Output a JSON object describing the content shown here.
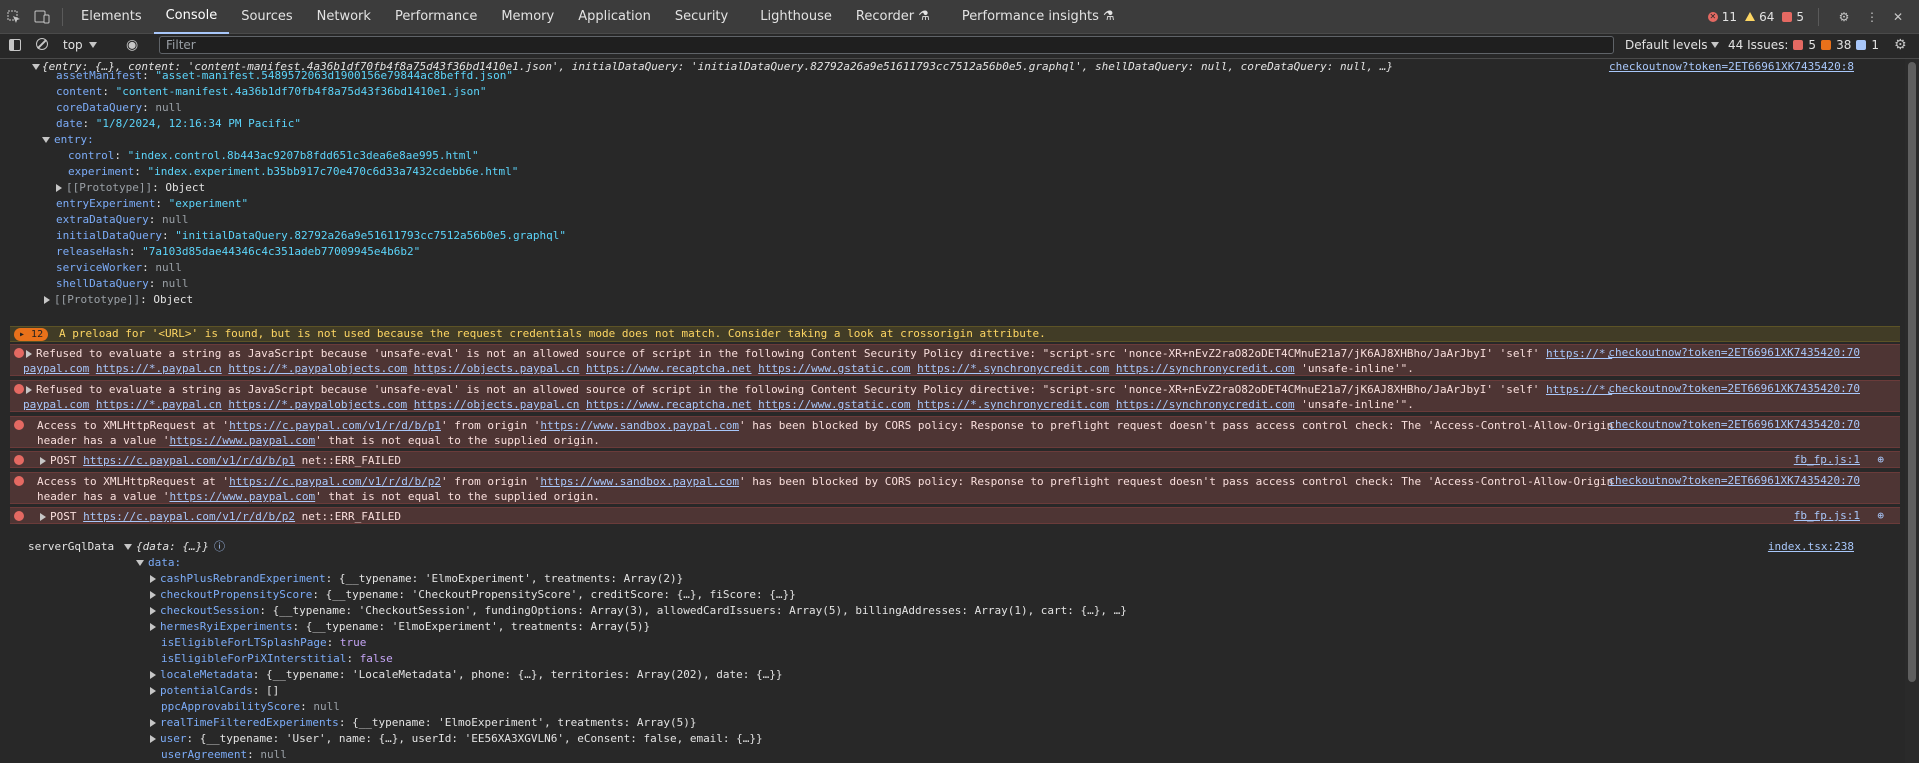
{
  "tabs": [
    "Elements",
    "Console",
    "Sources",
    "Network",
    "Performance",
    "Memory",
    "Application",
    "Security",
    "Lighthouse",
    "Recorder",
    "Performance insights"
  ],
  "status": {
    "errors": "11",
    "warnings": "64",
    "issues_small": "5"
  },
  "filter": {
    "context": "top",
    "placeholder": "Filter",
    "levels": "Default levels",
    "issues_label": "44 Issues:",
    "issue_err": "5",
    "issue_warn": "38",
    "issue_info": "1"
  },
  "console": {
    "obj_summary": "{entry: {…}, content: 'content-manifest.4a36b1df70fb4f8a75d43f36bd1410e1.json', initialDataQuery: 'initialDataQuery.82792a26a9e51611793cc7512a56b0e5.graphql', shellDataQuery: null, coreDataQuery: null, …}",
    "obj_src": "checkoutnow?token=2ET66961XK7435420:8",
    "props": [
      {
        "k": "assetManifest",
        "v": "\"asset-manifest.5489572063d1900156e79844ac8beffd.json\""
      },
      {
        "k": "content",
        "v": "\"content-manifest.4a36b1df70fb4f8a75d43f36bd1410e1.json\""
      },
      {
        "k": "coreDataQuery",
        "v": "null"
      },
      {
        "k": "date",
        "v": "\"1/8/2024, 12:16:34 PM Pacific\""
      }
    ],
    "entry_label": "entry:",
    "entry_props": [
      {
        "k": "control",
        "v": "\"index.control.8b443ac9207b8fdd651c3dea6e8ae995.html\""
      },
      {
        "k": "experiment",
        "v": "\"index.experiment.b35bb917c70e470c6d33a7432cdebb6e.html\""
      }
    ],
    "proto_label": "[[Prototype]]",
    "proto_val": "Object",
    "props2": [
      {
        "k": "entryExperiment",
        "v": "\"experiment\""
      },
      {
        "k": "extraDataQuery",
        "v": "null"
      },
      {
        "k": "initialDataQuery",
        "v": "\"initialDataQuery.82792a26a9e51611793cc7512a56b0e5.graphql\""
      },
      {
        "k": "releaseHash",
        "v": "\"7a103d85dae44346c4c351adeb77009945e4b6b2\""
      },
      {
        "k": "serviceWorker",
        "v": "null"
      },
      {
        "k": "shellDataQuery",
        "v": "null"
      }
    ],
    "warn_count": "12",
    "warn_text": "A preload for '<URL>' is found, but is not used because the request credentials mode does not match. Consider taking a look at crossorigin attribute.",
    "csp_line1": "Refused to evaluate a string as JavaScript because 'unsafe-eval' is not an allowed source of script in the following Content Security Policy directive: \"script-src 'nonce-XR+nEvZ2raO82oDET4CMnuE21a7/jK6AJ8XHBho/JaArJbyI' 'self'",
    "csp_link0": "https://*.",
    "csp_links": [
      "paypal.com",
      "https://*.paypal.cn",
      "https://*.paypalobjects.com",
      "https://objects.paypal.cn",
      "https://www.recaptcha.net",
      "https://www.gstatic.com",
      "https://*.synchronycredit.com",
      "https://synchronycredit.com"
    ],
    "csp_tail": "'unsafe-inline'\".",
    "csp_src": "checkoutnow?token=2ET66961XK7435420:70",
    "cors1_pre": "Access to XMLHttpRequest at '",
    "cors1_url": "https://c.paypal.com/v1/r/d/b/p1",
    "cors_mid": "' from origin '",
    "cors_origin": "https://www.sandbox.paypal.com",
    "cors_post": "' has been blocked by CORS policy: Response to preflight request doesn't pass access control check: The 'Access-Control-Allow-Origin'",
    "cors_l2_pre": "header has a value '",
    "cors_l2_url": "https://www.paypal.com",
    "cors_l2_post": "' that is not equal to the supplied origin.",
    "post_label": "POST",
    "post1_url": "https://c.paypal.com/v1/r/d/b/p1",
    "post_err": "net::ERR_FAILED",
    "post_src": "fb_fp.js:1",
    "cors2_url": "https://c.paypal.com/v1/r/d/b/p2",
    "post2_url": "https://c.paypal.com/v1/r/d/b/p2",
    "gql_label": "serverGqlData",
    "gql_summary": "{data: {…}}",
    "gql_src": "index.tsx:238",
    "data_label": "data:",
    "gql_rows": [
      {
        "k": "cashPlusRebrandExperiment",
        "v": "{__typename: 'ElmoExperiment', treatments: Array(2)}",
        "exp": true
      },
      {
        "k": "checkoutPropensityScore",
        "v": "{__typename: 'CheckoutPropensityScore', creditScore: {…}, fiScore: {…}}",
        "exp": true
      },
      {
        "k": "checkoutSession",
        "v": "{__typename: 'CheckoutSession', fundingOptions: Array(3), allowedCardIssuers: Array(5), billingAddresses: Array(1), cart: {…}, …}",
        "exp": true
      },
      {
        "k": "hermesRyiExperiments",
        "v": "{__typename: 'ElmoExperiment', treatments: Array(5)}",
        "exp": true
      },
      {
        "k": "isEligibleForLTSplashPage",
        "v": "true",
        "exp": false
      },
      {
        "k": "isEligibleForPiXInterstitial",
        "v": "false",
        "exp": false
      },
      {
        "k": "localeMetadata",
        "v": "{__typename: 'LocaleMetadata', phone: {…}, territories: Array(202), date: {…}}",
        "exp": true
      },
      {
        "k": "potentialCards",
        "v": "[]",
        "exp": true
      },
      {
        "k": "ppcApprovabilityScore",
        "v": "null",
        "exp": false
      },
      {
        "k": "realTimeFilteredExperiments",
        "v": "{__typename: 'ElmoExperiment', treatments: Array(5)}",
        "exp": true
      },
      {
        "k": "user",
        "v": "{__typename: 'User', name: {…}, userId: 'EE56XA3XGVLN6', eConsent: false, email: {…}}",
        "exp": true
      },
      {
        "k": "userAgreement",
        "v": "null",
        "exp": false
      }
    ]
  }
}
